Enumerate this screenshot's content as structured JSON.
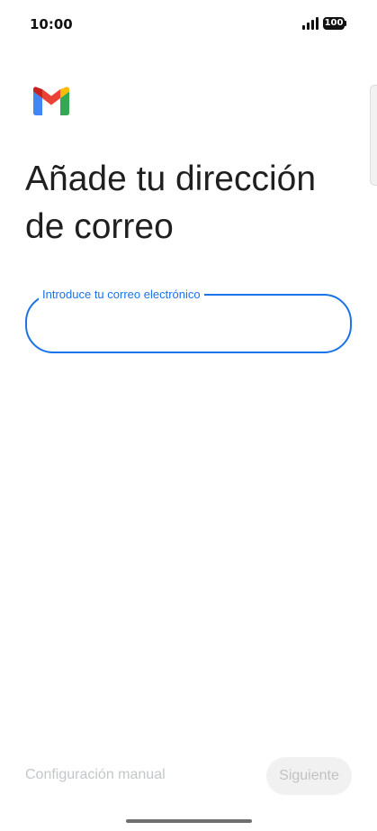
{
  "status_bar": {
    "time": "10:00",
    "battery": "100",
    "signal_icon": "signal-bars-icon"
  },
  "brand": {
    "logo_icon": "gmail-logo-icon",
    "colors": {
      "blue": "#4285F4",
      "red": "#EA4335",
      "yellow": "#FBBC04",
      "green": "#34A853",
      "dark_red": "#C5221F"
    }
  },
  "page": {
    "title": "Añade tu dirección de correo"
  },
  "email_field": {
    "label": "Introduce tu correo electrónico",
    "value": "",
    "accent_color": "#1a73e8"
  },
  "actions": {
    "manual_setup": "Configuración manual",
    "next": "Siguiente"
  }
}
